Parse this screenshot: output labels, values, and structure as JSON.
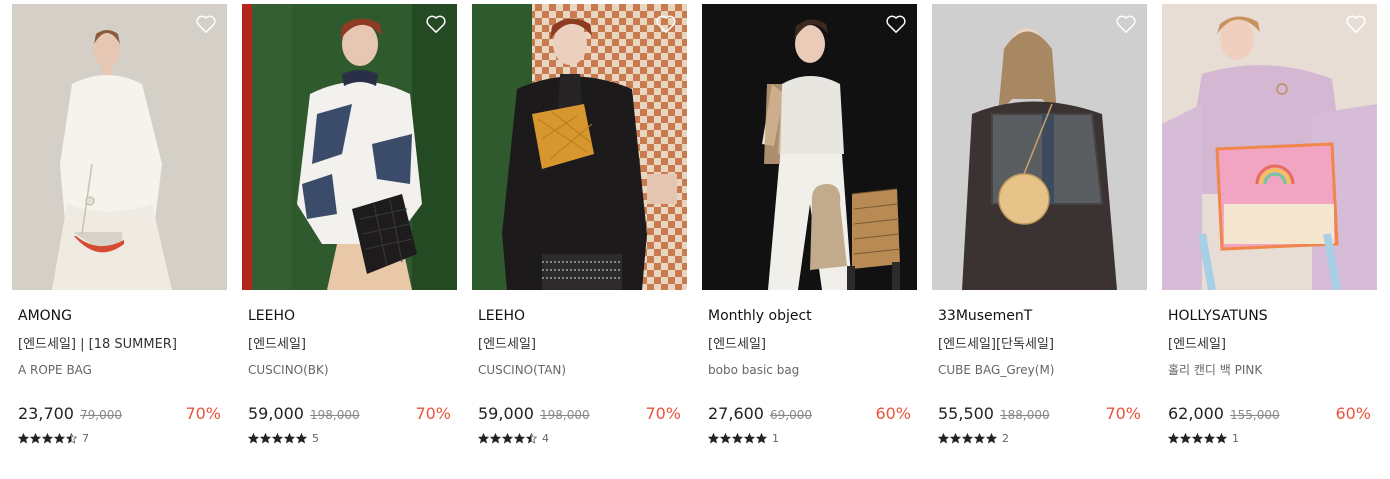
{
  "products": [
    {
      "brand": "AMONG",
      "tag": "[엔드세일] | [18 SUMMER]",
      "name": "A ROPE BAG",
      "price": "23,700",
      "original_price": "79,000",
      "discount": "70%",
      "rating": 4.5,
      "review_count": "7",
      "image_desc": "model-white-dress-rope-bag"
    },
    {
      "brand": "LEEHO",
      "tag": "[엔드세일]",
      "name": "CUSCINO(BK)",
      "price": "59,000",
      "original_price": "198,000",
      "discount": "70%",
      "rating": 5,
      "review_count": "5",
      "image_desc": "model-sweater-black-quilted-bag"
    },
    {
      "brand": "LEEHO",
      "tag": "[엔드세일]",
      "name": "CUSCINO(TAN)",
      "price": "59,000",
      "original_price": "198,000",
      "discount": "70%",
      "rating": 4.5,
      "review_count": "4",
      "image_desc": "model-black-coat-tan-quilted-bag"
    },
    {
      "brand": "Monthly object",
      "tag": "[엔드세일]",
      "name": "bobo basic bag",
      "price": "27,600",
      "original_price": "69,000",
      "discount": "60%",
      "rating": 5,
      "review_count": "1",
      "image_desc": "model-white-outfit-metallic-bag"
    },
    {
      "brand": "33MusemenT",
      "tag": "[엔드세일][단독세일]",
      "name": "CUBE BAG_Grey(M)",
      "price": "55,500",
      "original_price": "188,000",
      "discount": "70%",
      "rating": 5,
      "review_count": "2",
      "image_desc": "model-grey-cube-tote-bag"
    },
    {
      "brand": "HOLLYSATUNS",
      "tag": "[엔드세일]",
      "name": "홀리 캔디 백 PINK",
      "price": "62,000",
      "original_price": "155,000",
      "discount": "60%",
      "rating": 5,
      "review_count": "1",
      "image_desc": "model-lavender-hoodie-pink-candy-bag"
    }
  ],
  "colors": {
    "discount": "#e8553f",
    "star": "#222222",
    "heart": "#ffffff"
  }
}
